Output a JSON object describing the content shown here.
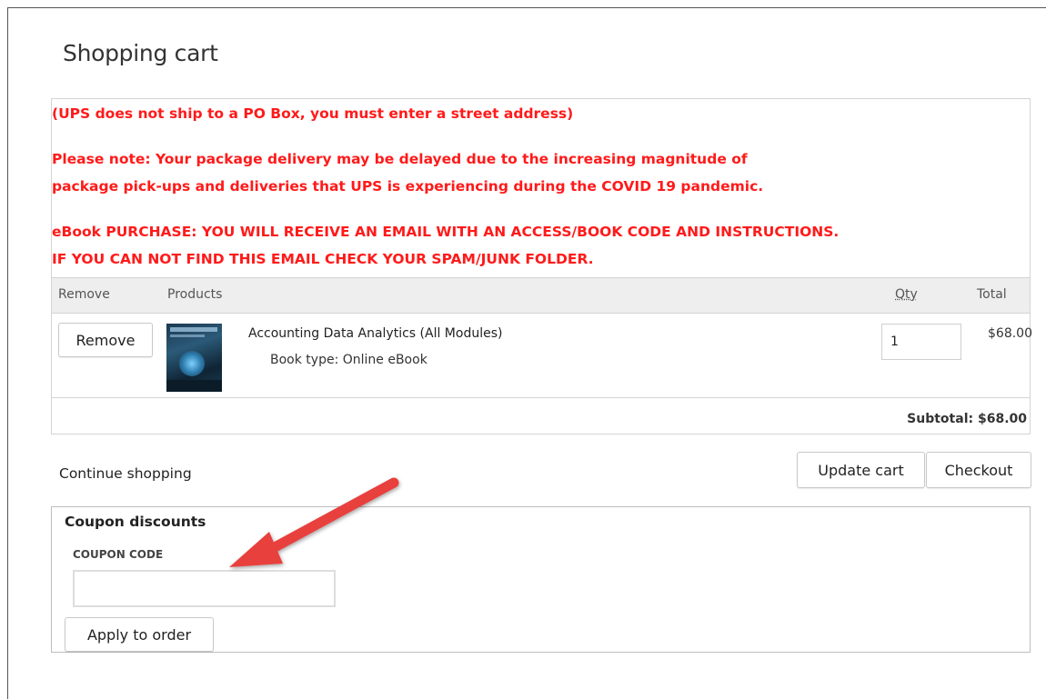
{
  "page": {
    "title": "Shopping cart"
  },
  "notices": {
    "po_box": "(UPS does not ship to a PO Box, you must enter a street address)",
    "covid_line1": "Please note: Your package delivery may be delayed due to the increasing magnitude of",
    "covid_line2": "package pick-ups and deliveries that UPS is experiencing during the COVID 19 pandemic.",
    "ebook_line1": "eBook PURCHASE: YOU WILL RECEIVE AN EMAIL WITH AN ACCESS/BOOK CODE AND INSTRUCTIONS.",
    "ebook_line2": "IF YOU CAN NOT FIND THIS EMAIL CHECK YOUR SPAM/JUNK FOLDER.",
    "color": "#ff1a1a"
  },
  "table": {
    "headers": {
      "remove": "Remove",
      "products": "Products",
      "qty": "Qty",
      "total": "Total"
    },
    "rows": [
      {
        "remove_label": "Remove",
        "product_name": "Accounting Data Analytics (All Modules)",
        "book_type": "Book type: Online eBook",
        "qty": "1",
        "total": "$68.00",
        "thumbnail_icon": "book-cover-image"
      }
    ],
    "subtotal": "Subtotal: $68.00"
  },
  "actions": {
    "continue_shopping": "Continue shopping",
    "update_cart": "Update cart",
    "checkout": "Checkout"
  },
  "coupon": {
    "title": "Coupon discounts",
    "label": "COUPON CODE",
    "value": "",
    "apply_label": "Apply to order"
  },
  "annotation": {
    "arrow_icon": "red-arrow-pointing-to-coupon-field",
    "color": "#e8413c"
  }
}
